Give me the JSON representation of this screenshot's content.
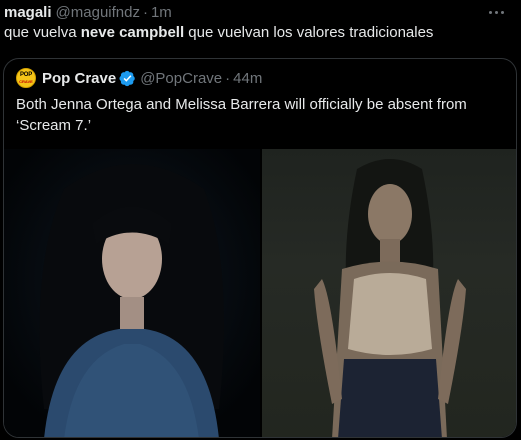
{
  "tweet": {
    "author_name": "magali",
    "handle": "@maguifndz",
    "separator": "·",
    "time": "1m",
    "text_before": "que vuelva ",
    "text_bold": "neve campbell",
    "text_after": " que vuelvan los valores tradicionales",
    "more_icon": "more-horizontal-icon"
  },
  "quote": {
    "avatar_line1": "POP",
    "avatar_line2": "CRAVE",
    "author_name": "Pop Crave",
    "verified_icon": "verified-badge-icon",
    "verified_color": "#1d9bf0",
    "handle": "@PopCrave",
    "separator": "·",
    "time": "44m",
    "text": "Both Jenna Ortega and Melissa Barrera will officially be absent from ‘Scream 7.’"
  },
  "colors": {
    "background": "#000000",
    "text_primary": "#e7e9ea",
    "text_secondary": "#71767b",
    "border": "#2f3336"
  }
}
